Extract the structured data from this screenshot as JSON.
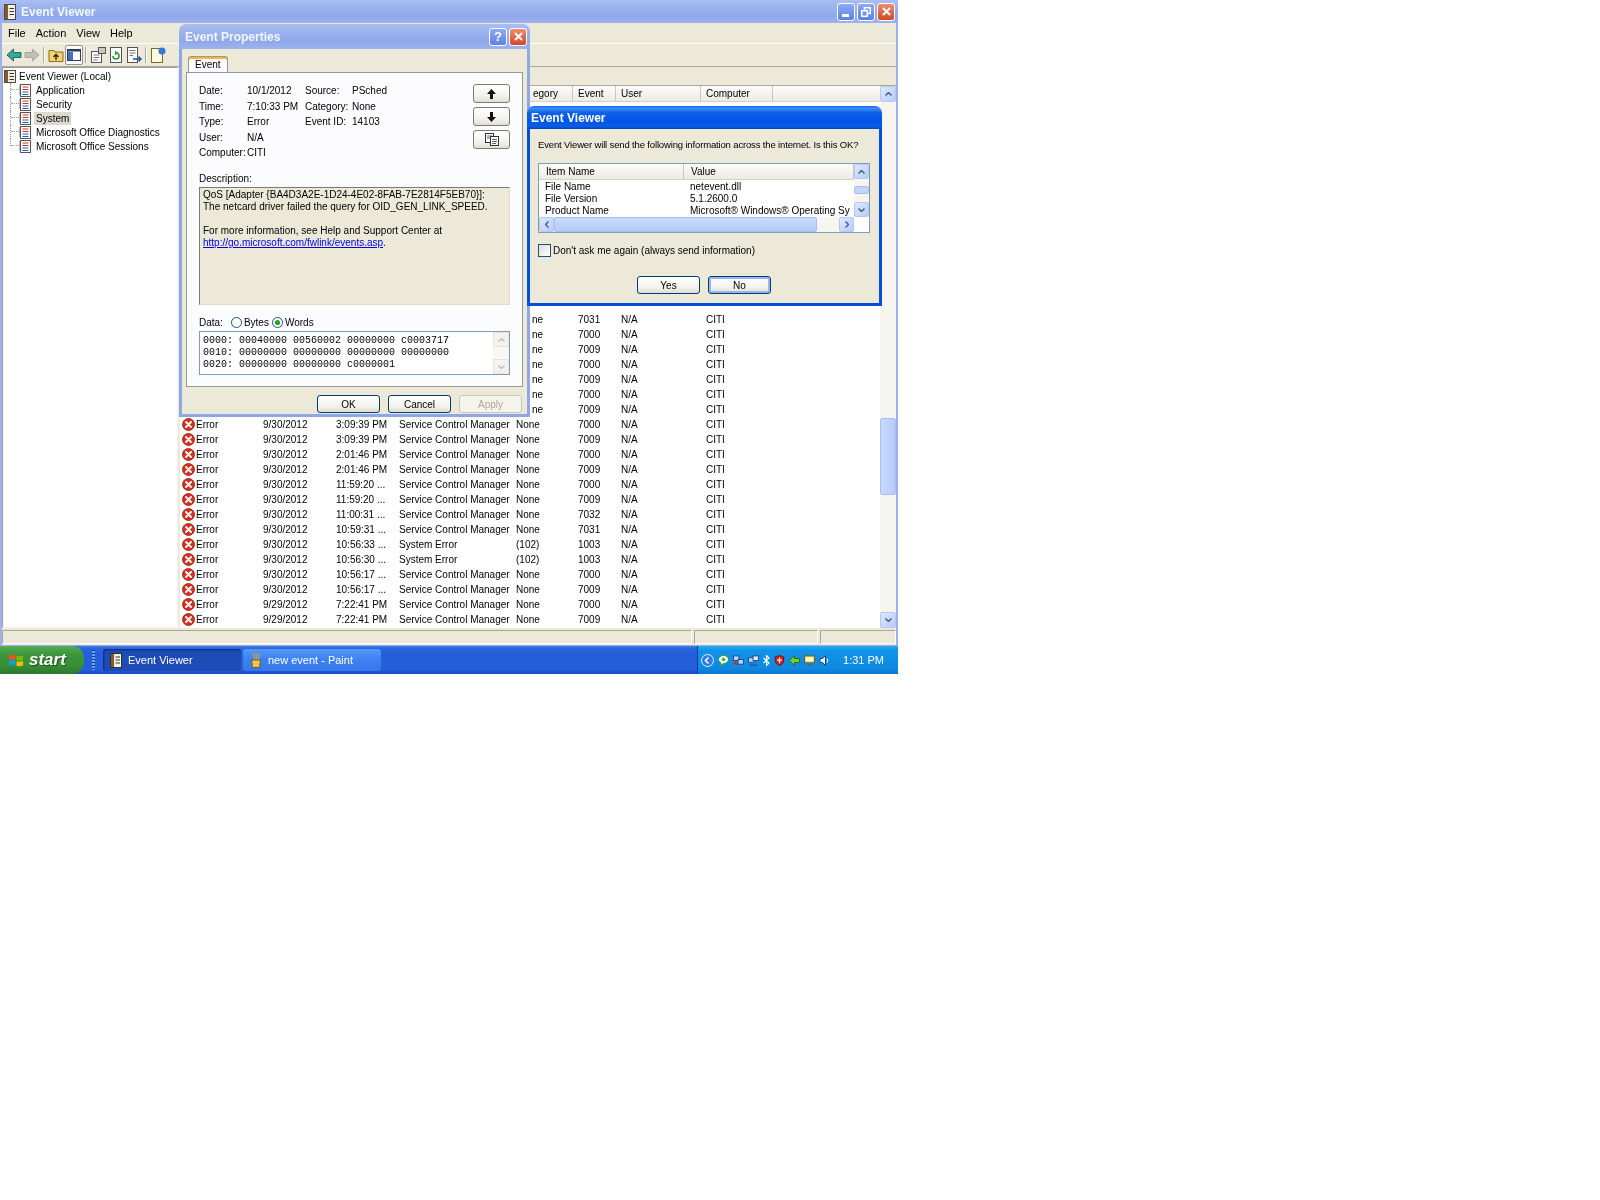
{
  "window": {
    "title": "Event Viewer",
    "active": false
  },
  "menu": [
    "File",
    "Action",
    "View",
    "Help"
  ],
  "toolbar": [
    {
      "kind": "back",
      "disabled": false,
      "pressed": false
    },
    {
      "kind": "forward",
      "disabled": true,
      "pressed": false
    },
    {
      "kind": "separator"
    },
    {
      "kind": "up",
      "disabled": false,
      "pressed": false
    },
    {
      "kind": "tree",
      "disabled": false,
      "pressed": true
    },
    {
      "kind": "separator"
    },
    {
      "kind": "properties",
      "disabled": false,
      "pressed": false
    },
    {
      "kind": "refresh",
      "disabled": false,
      "pressed": false
    },
    {
      "kind": "export",
      "disabled": false,
      "pressed": false
    },
    {
      "kind": "separator"
    },
    {
      "kind": "help",
      "disabled": false,
      "pressed": false
    }
  ],
  "tree": [
    {
      "label": "Event Viewer (Local)",
      "selected": false,
      "children": [
        {
          "label": "Application",
          "selected": false
        },
        {
          "label": "Security",
          "selected": false
        },
        {
          "label": "System",
          "selected": true
        },
        {
          "label": "Microsoft Office Diagnostics",
          "selected": false
        },
        {
          "label": "Microsoft Office Sessions",
          "selected": false
        }
      ]
    }
  ],
  "event_list": {
    "columns": [
      "egory",
      "Event",
      "User",
      "Computer"
    ],
    "rows": [
      {
        "kind": "clipped",
        "category": "ne",
        "event": "7031",
        "user": "N/A",
        "computer": "CITI"
      },
      {
        "kind": "clipped",
        "category": "ne",
        "event": "7000",
        "user": "N/A",
        "computer": "CITI"
      },
      {
        "kind": "clipped",
        "category": "ne",
        "event": "7009",
        "user": "N/A",
        "computer": "CITI"
      },
      {
        "kind": "clipped",
        "category": "ne",
        "event": "7000",
        "user": "N/A",
        "computer": "CITI"
      },
      {
        "kind": "clipped",
        "category": "ne",
        "event": "7009",
        "user": "N/A",
        "computer": "CITI"
      },
      {
        "kind": "clipped",
        "category": "ne",
        "event": "7000",
        "user": "N/A",
        "computer": "CITI"
      },
      {
        "kind": "clipped",
        "category": "ne",
        "event": "7009",
        "user": "N/A",
        "computer": "CITI"
      },
      {
        "kind": "entry",
        "type": "Error",
        "date": "9/30/2012",
        "time": "3:09:39 PM",
        "source": "Service Control Manager",
        "category": "None",
        "event": "7000",
        "user": "N/A",
        "computer": "CITI"
      },
      {
        "kind": "entry",
        "type": "Error",
        "date": "9/30/2012",
        "time": "3:09:39 PM",
        "source": "Service Control Manager",
        "category": "None",
        "event": "7009",
        "user": "N/A",
        "computer": "CITI"
      },
      {
        "kind": "entry",
        "type": "Error",
        "date": "9/30/2012",
        "time": "2:01:46 PM",
        "source": "Service Control Manager",
        "category": "None",
        "event": "7000",
        "user": "N/A",
        "computer": "CITI"
      },
      {
        "kind": "entry",
        "type": "Error",
        "date": "9/30/2012",
        "time": "2:01:46 PM",
        "source": "Service Control Manager",
        "category": "None",
        "event": "7009",
        "user": "N/A",
        "computer": "CITI"
      },
      {
        "kind": "entry",
        "type": "Error",
        "date": "9/30/2012",
        "time": "11:59:20 ...",
        "source": "Service Control Manager",
        "category": "None",
        "event": "7000",
        "user": "N/A",
        "computer": "CITI"
      },
      {
        "kind": "entry",
        "type": "Error",
        "date": "9/30/2012",
        "time": "11:59:20 ...",
        "source": "Service Control Manager",
        "category": "None",
        "event": "7009",
        "user": "N/A",
        "computer": "CITI"
      },
      {
        "kind": "entry",
        "type": "Error",
        "date": "9/30/2012",
        "time": "11:00:31 ...",
        "source": "Service Control Manager",
        "category": "None",
        "event": "7032",
        "user": "N/A",
        "computer": "CITI"
      },
      {
        "kind": "entry",
        "type": "Error",
        "date": "9/30/2012",
        "time": "10:59:31 ...",
        "source": "Service Control Manager",
        "category": "None",
        "event": "7031",
        "user": "N/A",
        "computer": "CITI"
      },
      {
        "kind": "entry",
        "type": "Error",
        "date": "9/30/2012",
        "time": "10:56:33 ...",
        "source": "System Error",
        "category": "(102)",
        "event": "1003",
        "user": "N/A",
        "computer": "CITI"
      },
      {
        "kind": "entry",
        "type": "Error",
        "date": "9/30/2012",
        "time": "10:56:30 ...",
        "source": "System Error",
        "category": "(102)",
        "event": "1003",
        "user": "N/A",
        "computer": "CITI"
      },
      {
        "kind": "entry",
        "type": "Error",
        "date": "9/30/2012",
        "time": "10:56:17 ...",
        "source": "Service Control Manager",
        "category": "None",
        "event": "7000",
        "user": "N/A",
        "computer": "CITI"
      },
      {
        "kind": "entry",
        "type": "Error",
        "date": "9/30/2012",
        "time": "10:56:17 ...",
        "source": "Service Control Manager",
        "category": "None",
        "event": "7009",
        "user": "N/A",
        "computer": "CITI"
      },
      {
        "kind": "entry",
        "type": "Error",
        "date": "9/29/2012",
        "time": "7:22:41 PM",
        "source": "Service Control Manager",
        "category": "None",
        "event": "7000",
        "user": "N/A",
        "computer": "CITI"
      },
      {
        "kind": "entry",
        "type": "Error",
        "date": "9/29/2012",
        "time": "7:22:41 PM",
        "source": "Service Control Manager",
        "category": "None",
        "event": "7009",
        "user": "N/A",
        "computer": "CITI"
      }
    ]
  },
  "event_properties": {
    "title": "Event Properties",
    "active": false,
    "help": "?",
    "tabs": [
      {
        "label": "Event",
        "selected": true
      }
    ],
    "left_fields": [
      {
        "label": "Date:",
        "value": "10/1/2012"
      },
      {
        "label": "Time:",
        "value": "7:10:33 PM"
      },
      {
        "label": "Type:",
        "value": "Error"
      },
      {
        "label": "User:",
        "value": "N/A"
      },
      {
        "label": "Computer:",
        "value": "CITI"
      }
    ],
    "right_fields": [
      {
        "label": "Source:",
        "value": "PSched"
      },
      {
        "label": "Category:",
        "value": "None"
      },
      {
        "label": "Event ID:",
        "value": "14103"
      }
    ],
    "description": {
      "label": "Description:",
      "lines": [
        "QoS [Adapter {BA4D3A2E-1D24-4E02-8FAB-7E2814F5EB70}]:",
        "The netcard driver failed the query for OID_GEN_LINK_SPEED."
      ],
      "more_info": "For more information, see Help and Support Center at",
      "link": "http://go.microsoft.com/fwlink/events.asp",
      "after_link": "."
    },
    "data": {
      "label": "Data:",
      "formats": [
        {
          "label": "Bytes",
          "selected": false
        },
        {
          "label": "Words",
          "selected": true
        }
      ],
      "lines": [
        "0000: 00040000 00560002 00000000 c0003717",
        "0010: 00000000 00000000 00000000 00000000",
        "0020: 00000000 00000000 c0000001"
      ]
    },
    "buttons": [
      {
        "label": "OK",
        "disabled": false
      },
      {
        "label": "Cancel",
        "disabled": false
      },
      {
        "label": "Apply",
        "disabled": true
      }
    ]
  },
  "confirm_dialog": {
    "title": "Event Viewer",
    "active": true,
    "message": "Event Viewer will send the following information across the internet. Is this OK?",
    "columns": [
      "Item Name",
      "Value"
    ],
    "rows": [
      {
        "item": "File Name",
        "value": "netevent.dll"
      },
      {
        "item": "File Version",
        "value": "5.1.2600.0"
      },
      {
        "item": "Product Name",
        "value": "Microsoft® Windows® Operating Sy"
      }
    ],
    "checkbox": {
      "label": "Don't ask me again (always send information)",
      "checked": false
    },
    "buttons": [
      {
        "label": "Yes",
        "default": false
      },
      {
        "label": "No",
        "default": true
      }
    ]
  },
  "taskbar": {
    "start": "start",
    "tasks": [
      {
        "kind": "viewer",
        "label": "Event Viewer",
        "selected": true
      },
      {
        "kind": "paint",
        "label": "new event - Paint",
        "selected": false
      }
    ],
    "clock": "1:31 PM"
  }
}
